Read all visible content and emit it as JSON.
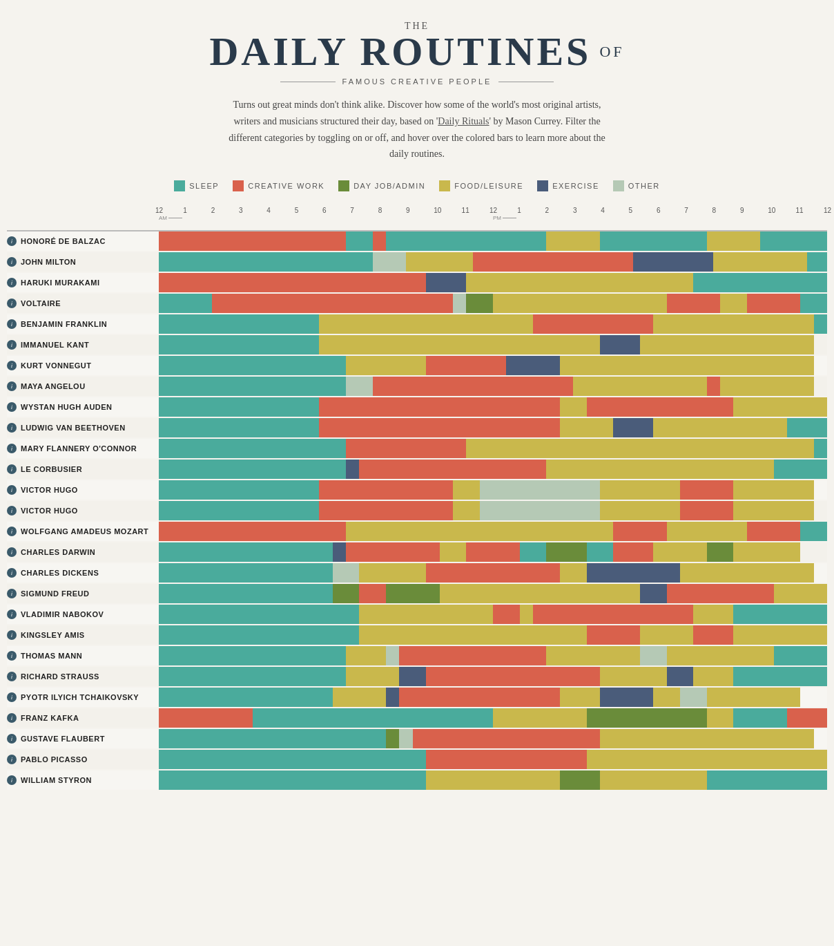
{
  "header": {
    "the": "THE",
    "title": "DAILY ROUTINES",
    "of": "OF",
    "subtitle": "FAMOUS CREATIVE PEOPLE",
    "description": "Turns out great minds don't think alike. Discover how some of the world's most original artists, writers and musicians structured their day, based on 'Daily Rituals' by Mason Currey. Filter the different categories by toggling on or off, and hover over the colored bars to learn more about the daily routines.",
    "link_text": "Daily Rituals"
  },
  "legend": [
    {
      "label": "SLEEP",
      "color": "#4aab9c"
    },
    {
      "label": "CREATIVE WORK",
      "color": "#d9614c"
    },
    {
      "label": "DAY JOB/ADMIN",
      "color": "#6a8c3a"
    },
    {
      "label": "FOOD/LEISURE",
      "color": "#c9b84c"
    },
    {
      "label": "EXERCISE",
      "color": "#4a5c7a"
    },
    {
      "label": "OTHER",
      "color": "#b5c9b5"
    }
  ],
  "colors": {
    "sleep": "#4aab9c",
    "creative": "#d9614c",
    "dayJob": "#6a8c3a",
    "food": "#c9b84c",
    "exercise": "#4a5c7a",
    "other": "#b5c9b5",
    "lightSleep": "#7ac4b8"
  },
  "timeLabels": [
    "12",
    "1",
    "2",
    "3",
    "4",
    "5",
    "6",
    "7",
    "8",
    "9",
    "10",
    "11",
    "12",
    "1",
    "2",
    "3",
    "4",
    "5",
    "6",
    "7",
    "8",
    "9",
    "10",
    "11",
    "12"
  ],
  "people": [
    {
      "name": "HONORÉ DE BALZAC",
      "segments": [
        {
          "type": "creative",
          "start": 0,
          "width": 28
        },
        {
          "type": "sleep",
          "start": 28,
          "width": 4
        },
        {
          "type": "creative",
          "start": 32,
          "width": 2
        },
        {
          "type": "sleep",
          "start": 34,
          "width": 24
        },
        {
          "type": "food",
          "start": 58,
          "width": 8
        },
        {
          "type": "sleep",
          "start": 66,
          "width": 16
        },
        {
          "type": "food",
          "start": 82,
          "width": 8
        },
        {
          "type": "sleep",
          "start": 90,
          "width": 10
        }
      ]
    },
    {
      "name": "JOHN MILTON",
      "segments": [
        {
          "type": "sleep",
          "start": 0,
          "width": 32
        },
        {
          "type": "other",
          "start": 32,
          "width": 5
        },
        {
          "type": "food",
          "start": 37,
          "width": 10
        },
        {
          "type": "creative",
          "start": 47,
          "width": 24
        },
        {
          "type": "exercise",
          "start": 71,
          "width": 12
        },
        {
          "type": "food",
          "start": 83,
          "width": 14
        },
        {
          "type": "sleep",
          "start": 97,
          "width": 3
        }
      ]
    },
    {
      "name": "HARUKI MURAKAMI",
      "segments": [
        {
          "type": "creative",
          "start": 0,
          "width": 40
        },
        {
          "type": "exercise",
          "start": 40,
          "width": 6
        },
        {
          "type": "food",
          "start": 46,
          "width": 34
        },
        {
          "type": "sleep",
          "start": 80,
          "width": 20
        }
      ]
    },
    {
      "name": "VOLTAIRE",
      "segments": [
        {
          "type": "sleep",
          "start": 0,
          "width": 8
        },
        {
          "type": "creative",
          "start": 8,
          "width": 36
        },
        {
          "type": "other",
          "start": 44,
          "width": 2
        },
        {
          "type": "dayJob",
          "start": 46,
          "width": 4
        },
        {
          "type": "food",
          "start": 50,
          "width": 26
        },
        {
          "type": "creative",
          "start": 76,
          "width": 8
        },
        {
          "type": "food",
          "start": 84,
          "width": 4
        },
        {
          "type": "creative",
          "start": 88,
          "width": 8
        },
        {
          "type": "sleep",
          "start": 96,
          "width": 4
        }
      ]
    },
    {
      "name": "BENJAMIN FRANKLIN",
      "segments": [
        {
          "type": "sleep",
          "start": 0,
          "width": 24
        },
        {
          "type": "food",
          "start": 24,
          "width": 32
        },
        {
          "type": "creative",
          "start": 56,
          "width": 18
        },
        {
          "type": "food",
          "start": 74,
          "width": 24
        },
        {
          "type": "sleep",
          "start": 98,
          "width": 2
        }
      ]
    },
    {
      "name": "IMMANUEL KANT",
      "segments": [
        {
          "type": "sleep",
          "start": 0,
          "width": 24
        },
        {
          "type": "food",
          "start": 24,
          "width": 42
        },
        {
          "type": "exercise",
          "start": 66,
          "width": 6
        },
        {
          "type": "food",
          "start": 72,
          "width": 26
        }
      ]
    },
    {
      "name": "KURT VONNEGUT",
      "segments": [
        {
          "type": "sleep",
          "start": 0,
          "width": 28
        },
        {
          "type": "food",
          "start": 28,
          "width": 12
        },
        {
          "type": "creative",
          "start": 40,
          "width": 12
        },
        {
          "type": "exercise",
          "start": 52,
          "width": 8
        },
        {
          "type": "food",
          "start": 60,
          "width": 38
        }
      ]
    },
    {
      "name": "MAYA ANGELOU",
      "segments": [
        {
          "type": "sleep",
          "start": 0,
          "width": 28
        },
        {
          "type": "other",
          "start": 28,
          "width": 4
        },
        {
          "type": "creative",
          "start": 32,
          "width": 30
        },
        {
          "type": "food",
          "start": 62,
          "width": 20
        },
        {
          "type": "creative",
          "start": 82,
          "width": 2
        },
        {
          "type": "food",
          "start": 84,
          "width": 14
        }
      ]
    },
    {
      "name": "WYSTAN HUGH AUDEN",
      "segments": [
        {
          "type": "sleep",
          "start": 0,
          "width": 24
        },
        {
          "type": "creative",
          "start": 24,
          "width": 36
        },
        {
          "type": "food",
          "start": 60,
          "width": 4
        },
        {
          "type": "creative",
          "start": 64,
          "width": 22
        },
        {
          "type": "food",
          "start": 86,
          "width": 14
        }
      ]
    },
    {
      "name": "LUDWIG VAN BEETHOVEN",
      "segments": [
        {
          "type": "sleep",
          "start": 0,
          "width": 24
        },
        {
          "type": "creative",
          "start": 24,
          "width": 36
        },
        {
          "type": "food",
          "start": 60,
          "width": 8
        },
        {
          "type": "exercise",
          "start": 68,
          "width": 6
        },
        {
          "type": "food",
          "start": 74,
          "width": 20
        },
        {
          "type": "sleep",
          "start": 94,
          "width": 6
        }
      ]
    },
    {
      "name": "MARY FLANNERY O'CONNOR",
      "segments": [
        {
          "type": "sleep",
          "start": 0,
          "width": 28
        },
        {
          "type": "creative",
          "start": 28,
          "width": 18
        },
        {
          "type": "food",
          "start": 46,
          "width": 16
        },
        {
          "type": "food",
          "start": 62,
          "width": 36
        },
        {
          "type": "sleep",
          "start": 98,
          "width": 2
        }
      ]
    },
    {
      "name": "LE CORBUSIER",
      "segments": [
        {
          "type": "sleep",
          "start": 0,
          "width": 28
        },
        {
          "type": "exercise",
          "start": 28,
          "width": 2
        },
        {
          "type": "creative",
          "start": 30,
          "width": 28
        },
        {
          "type": "food",
          "start": 58,
          "width": 16
        },
        {
          "type": "food",
          "start": 74,
          "width": 18
        },
        {
          "type": "sleep",
          "start": 92,
          "width": 8
        }
      ]
    },
    {
      "name": "VICTOR HUGO",
      "segments": [
        {
          "type": "sleep",
          "start": 0,
          "width": 24
        },
        {
          "type": "creative",
          "start": 24,
          "width": 20
        },
        {
          "type": "food",
          "start": 44,
          "width": 4
        },
        {
          "type": "other",
          "start": 48,
          "width": 12
        },
        {
          "type": "other",
          "start": 60,
          "width": 6
        },
        {
          "type": "food",
          "start": 66,
          "width": 12
        },
        {
          "type": "creative",
          "start": 78,
          "width": 8
        },
        {
          "type": "food",
          "start": 86,
          "width": 12
        }
      ]
    },
    {
      "name": "VICTOR HUGO",
      "segments": [
        {
          "type": "sleep",
          "start": 0,
          "width": 24
        },
        {
          "type": "creative",
          "start": 24,
          "width": 20
        },
        {
          "type": "food",
          "start": 44,
          "width": 4
        },
        {
          "type": "other",
          "start": 48,
          "width": 12
        },
        {
          "type": "other",
          "start": 60,
          "width": 6
        },
        {
          "type": "food",
          "start": 66,
          "width": 12
        },
        {
          "type": "creative",
          "start": 78,
          "width": 8
        },
        {
          "type": "food",
          "start": 86,
          "width": 12
        }
      ]
    },
    {
      "name": "WOLFGANG AMADEUS MOZART",
      "segments": [
        {
          "type": "creative",
          "start": 0,
          "width": 28
        },
        {
          "type": "food",
          "start": 28,
          "width": 40
        },
        {
          "type": "creative",
          "start": 68,
          "width": 8
        },
        {
          "type": "food",
          "start": 76,
          "width": 12
        },
        {
          "type": "creative",
          "start": 88,
          "width": 8
        },
        {
          "type": "sleep",
          "start": 96,
          "width": 4
        }
      ]
    },
    {
      "name": "CHARLES DARWIN",
      "segments": [
        {
          "type": "sleep",
          "start": 0,
          "width": 26
        },
        {
          "type": "exercise",
          "start": 26,
          "width": 2
        },
        {
          "type": "creative",
          "start": 28,
          "width": 14
        },
        {
          "type": "food",
          "start": 42,
          "width": 4
        },
        {
          "type": "creative",
          "start": 46,
          "width": 8
        },
        {
          "type": "sleep",
          "start": 54,
          "width": 4
        },
        {
          "type": "dayJob",
          "start": 58,
          "width": 6
        },
        {
          "type": "sleep",
          "start": 64,
          "width": 4
        },
        {
          "type": "creative",
          "start": 68,
          "width": 6
        },
        {
          "type": "food",
          "start": 74,
          "width": 8
        },
        {
          "type": "dayJob",
          "start": 82,
          "width": 4
        },
        {
          "type": "food",
          "start": 86,
          "width": 10
        }
      ]
    },
    {
      "name": "CHARLES DICKENS",
      "segments": [
        {
          "type": "sleep",
          "start": 0,
          "width": 26
        },
        {
          "type": "other",
          "start": 26,
          "width": 4
        },
        {
          "type": "food",
          "start": 30,
          "width": 10
        },
        {
          "type": "creative",
          "start": 40,
          "width": 20
        },
        {
          "type": "food",
          "start": 60,
          "width": 4
        },
        {
          "type": "exercise",
          "start": 64,
          "width": 14
        },
        {
          "type": "food",
          "start": 78,
          "width": 20
        }
      ]
    },
    {
      "name": "SIGMUND FREUD",
      "segments": [
        {
          "type": "sleep",
          "start": 0,
          "width": 26
        },
        {
          "type": "dayJob",
          "start": 26,
          "width": 4
        },
        {
          "type": "creative",
          "start": 30,
          "width": 4
        },
        {
          "type": "dayJob",
          "start": 34,
          "width": 8
        },
        {
          "type": "food",
          "start": 42,
          "width": 30
        },
        {
          "type": "exercise",
          "start": 72,
          "width": 4
        },
        {
          "type": "creative",
          "start": 76,
          "width": 16
        },
        {
          "type": "food",
          "start": 92,
          "width": 8
        }
      ]
    },
    {
      "name": "VLADIMIR NABOKOV",
      "segments": [
        {
          "type": "sleep",
          "start": 0,
          "width": 30
        },
        {
          "type": "food",
          "start": 30,
          "width": 20
        },
        {
          "type": "creative",
          "start": 50,
          "width": 4
        },
        {
          "type": "food",
          "start": 54,
          "width": 2
        },
        {
          "type": "creative",
          "start": 56,
          "width": 24
        },
        {
          "type": "food",
          "start": 80,
          "width": 6
        },
        {
          "type": "sleep",
          "start": 86,
          "width": 14
        }
      ]
    },
    {
      "name": "KINGSLEY AMIS",
      "segments": [
        {
          "type": "sleep",
          "start": 0,
          "width": 30
        },
        {
          "type": "food",
          "start": 30,
          "width": 34
        },
        {
          "type": "creative",
          "start": 64,
          "width": 8
        },
        {
          "type": "food",
          "start": 72,
          "width": 8
        },
        {
          "type": "creative",
          "start": 80,
          "width": 6
        },
        {
          "type": "food",
          "start": 86,
          "width": 14
        }
      ]
    },
    {
      "name": "THOMAS MANN",
      "segments": [
        {
          "type": "sleep",
          "start": 0,
          "width": 28
        },
        {
          "type": "food",
          "start": 28,
          "width": 6
        },
        {
          "type": "other",
          "start": 34,
          "width": 2
        },
        {
          "type": "creative",
          "start": 36,
          "width": 22
        },
        {
          "type": "food",
          "start": 58,
          "width": 8
        },
        {
          "type": "food",
          "start": 66,
          "width": 6
        },
        {
          "type": "other",
          "start": 72,
          "width": 4
        },
        {
          "type": "food",
          "start": 76,
          "width": 16
        },
        {
          "type": "sleep",
          "start": 92,
          "width": 8
        }
      ]
    },
    {
      "name": "RICHARD STRAUSS",
      "segments": [
        {
          "type": "sleep",
          "start": 0,
          "width": 28
        },
        {
          "type": "food",
          "start": 28,
          "width": 8
        },
        {
          "type": "exercise",
          "start": 36,
          "width": 4
        },
        {
          "type": "creative",
          "start": 40,
          "width": 26
        },
        {
          "type": "food",
          "start": 66,
          "width": 10
        },
        {
          "type": "exercise",
          "start": 76,
          "width": 4
        },
        {
          "type": "food",
          "start": 80,
          "width": 6
        },
        {
          "type": "sleep",
          "start": 86,
          "width": 14
        }
      ]
    },
    {
      "name": "PYOTR ILYICH TCHAIKOVSKY",
      "segments": [
        {
          "type": "sleep",
          "start": 0,
          "width": 26
        },
        {
          "type": "food",
          "start": 26,
          "width": 8
        },
        {
          "type": "exercise",
          "start": 34,
          "width": 2
        },
        {
          "type": "creative",
          "start": 36,
          "width": 24
        },
        {
          "type": "food",
          "start": 60,
          "width": 6
        },
        {
          "type": "exercise",
          "start": 66,
          "width": 8
        },
        {
          "type": "food",
          "start": 74,
          "width": 4
        },
        {
          "type": "other",
          "start": 78,
          "width": 4
        },
        {
          "type": "food",
          "start": 82,
          "width": 14
        }
      ]
    },
    {
      "name": "FRANZ KAFKA",
      "segments": [
        {
          "type": "creative",
          "start": 0,
          "width": 14
        },
        {
          "type": "sleep",
          "start": 14,
          "width": 36
        },
        {
          "type": "food",
          "start": 50,
          "width": 14
        },
        {
          "type": "dayJob",
          "start": 64,
          "width": 18
        },
        {
          "type": "food",
          "start": 82,
          "width": 4
        },
        {
          "type": "sleep",
          "start": 86,
          "width": 8
        },
        {
          "type": "creative",
          "start": 94,
          "width": 4
        },
        {
          "type": "creative",
          "start": 98,
          "width": 2
        }
      ]
    },
    {
      "name": "GUSTAVE FLAUBERT",
      "segments": [
        {
          "type": "sleep",
          "start": 0,
          "width": 34
        },
        {
          "type": "dayJob",
          "start": 34,
          "width": 2
        },
        {
          "type": "other",
          "start": 36,
          "width": 2
        },
        {
          "type": "creative",
          "start": 38,
          "width": 28
        },
        {
          "type": "food",
          "start": 66,
          "width": 32
        }
      ]
    },
    {
      "name": "PABLO PICASSO",
      "segments": [
        {
          "type": "sleep",
          "start": 0,
          "width": 40
        },
        {
          "type": "creative",
          "start": 40,
          "width": 24
        },
        {
          "type": "food",
          "start": 64,
          "width": 36
        }
      ]
    },
    {
      "name": "WILLIAM STYRON",
      "segments": [
        {
          "type": "sleep",
          "start": 0,
          "width": 40
        },
        {
          "type": "food",
          "start": 40,
          "width": 20
        },
        {
          "type": "dayJob",
          "start": 60,
          "width": 6
        },
        {
          "type": "food",
          "start": 66,
          "width": 16
        },
        {
          "type": "sleep",
          "start": 82,
          "width": 18
        }
      ]
    }
  ]
}
